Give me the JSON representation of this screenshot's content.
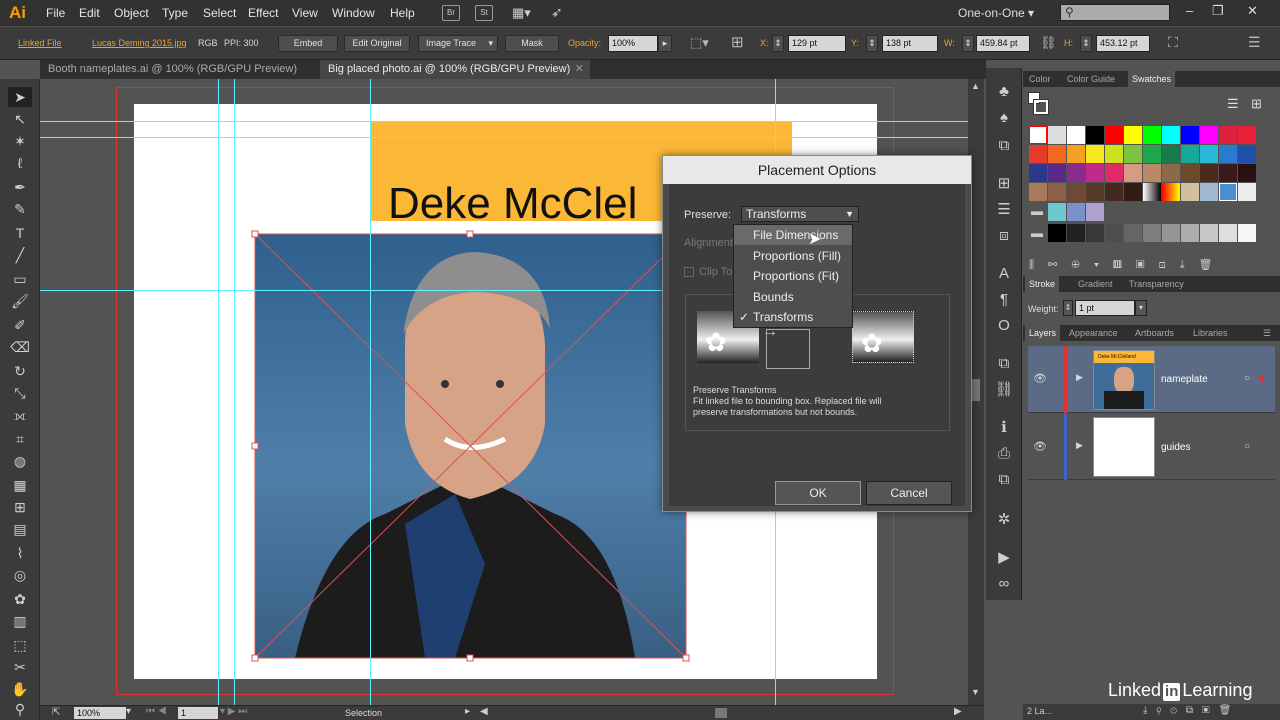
{
  "app": {
    "logo": "Ai"
  },
  "menu": [
    "File",
    "Edit",
    "Object",
    "Type",
    "Select",
    "Effect",
    "View",
    "Window",
    "Help"
  ],
  "menu_icons": {
    "bridge": "Br",
    "stock": "St"
  },
  "workspace": "One-on-One",
  "window_controls": {
    "minimize": "–",
    "maximize": "❐",
    "close": "✕"
  },
  "control_bar": {
    "linked_file": "Linked File",
    "file_name": "Lucas Deming 2015.jpg",
    "color_mode": "RGB",
    "ppi": "PPI: 300",
    "embed": "Embed",
    "edit_original": "Edit Original",
    "image_trace": "Image Trace",
    "mask": "Mask",
    "opacity_label": "Opacity:",
    "opacity": "100%",
    "x_label": "X:",
    "x": "129 pt",
    "y_label": "Y:",
    "y": "138 pt",
    "w_label": "W:",
    "w": "459.84 pt",
    "h_label": "H:",
    "h": "453.12 pt"
  },
  "doc_tabs": [
    {
      "label": "Booth nameplates.ai @ 100% (RGB/GPU Preview)"
    },
    {
      "label": "Big placed photo.ai @ 100% (RGB/GPU Preview)"
    }
  ],
  "artboard": {
    "heading": "Deke McClel"
  },
  "dialog": {
    "title": "Placement Options",
    "preserve_label": "Preserve:",
    "preserve_value": "Transforms",
    "alignment_label": "Alignment",
    "clip_label": "Clip To",
    "options": [
      "File Dimensions",
      "Proportions (Fill)",
      "Proportions (Fit)",
      "Bounds",
      "Transforms"
    ],
    "checked": "Transforms",
    "hovered": "File Dimensions",
    "desc_title": "Preserve Transforms",
    "desc_text": "Fit linked file to bounding box. Replaced file will preserve transformations but not bounds.",
    "ok": "OK",
    "cancel": "Cancel"
  },
  "panels": {
    "color_tabs": [
      "Color",
      "Color Guide",
      "Swatches"
    ],
    "stroke_tabs": [
      "Stroke",
      "Gradient",
      "Transparency"
    ],
    "weight_label": "Weight:",
    "weight": "1 pt",
    "layer_tabs": [
      "Layers",
      "Appearance",
      "Artboards",
      "Libraries"
    ],
    "layers": [
      {
        "name": "nameplate",
        "thumb_text": "Deke McClelland"
      },
      {
        "name": "guides"
      }
    ],
    "layers_count": "2 La..."
  },
  "status": {
    "zoom": "100%",
    "artboard": "1",
    "tool": "Selection"
  },
  "watermark": {
    "brand_a": "Linked",
    "brand_in": "in",
    "brand_b": "Learning"
  },
  "colors": {
    "accent": "#ff9a00",
    "heading_band": "#fbb736",
    "photo_bg": "#3f6d9a",
    "guide": "#5ff0ff",
    "bleed": "#e03030"
  }
}
